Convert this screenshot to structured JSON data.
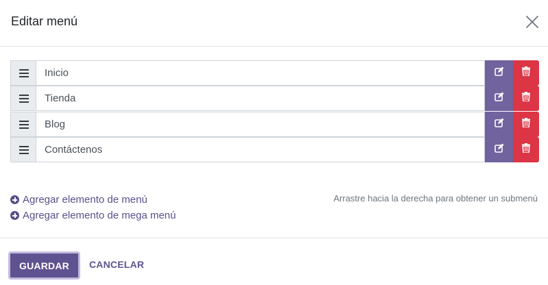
{
  "dialog": {
    "title": "Editar menú",
    "close_icon": "close-icon"
  },
  "menu": {
    "items": [
      {
        "label": "Inicio",
        "is_home": true
      },
      {
        "label": "Tienda",
        "is_home": false
      },
      {
        "label": "Blog",
        "is_home": false
      },
      {
        "label": "Contáctenos",
        "is_home": false
      }
    ],
    "icons": {
      "handle": "drag-handle-icon",
      "home": "home-icon",
      "edit": "edit-icon",
      "delete": "trash-icon"
    }
  },
  "actions": {
    "add_item": "Agregar elemento de menú",
    "add_mega": "Agregar elemento de mega menú",
    "hint": "Arrastre hacia la derecha para obtener un submenú"
  },
  "footer": {
    "save_label": "GUARDAR",
    "cancel_label": "CANCELAR"
  },
  "colors": {
    "primary": "#71639e",
    "danger": "#dc3545",
    "link": "#5b4e8a"
  }
}
